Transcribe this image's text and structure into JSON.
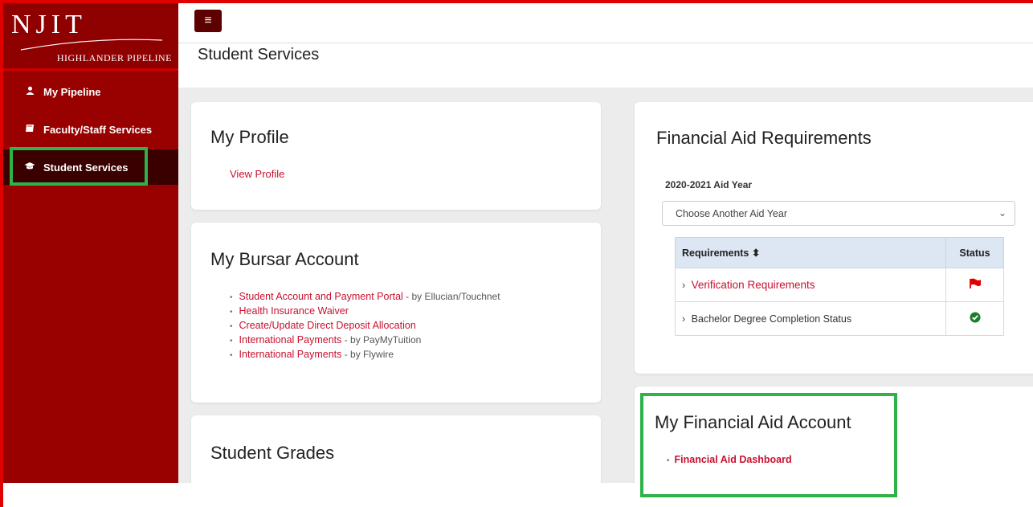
{
  "logo": {
    "name": "NJIT",
    "subtitle": "HIGHLANDER PIPELINE"
  },
  "sidebar": {
    "items": [
      {
        "label": "My Pipeline",
        "icon": "user-icon"
      },
      {
        "label": "Faculty/Staff Services",
        "icon": "book-icon"
      },
      {
        "label": "Student Services",
        "icon": "graduation-cap-icon"
      }
    ]
  },
  "header": {
    "menu_icon": "hamburger-icon",
    "title": "Student Services"
  },
  "profile": {
    "title": "My Profile",
    "link": "View Profile"
  },
  "bursar": {
    "title": "My Bursar Account",
    "links": [
      {
        "text": "Student Account and Payment Portal",
        "by": " - by Ellucian/Touchnet"
      },
      {
        "text": "Health Insurance Waiver",
        "by": ""
      },
      {
        "text": "Create/Update Direct Deposit Allocation",
        "by": ""
      },
      {
        "text": "International Payments",
        "by": " - by PayMyTuition"
      },
      {
        "text": "International Payments",
        "by": " - by Flywire"
      }
    ]
  },
  "grades": {
    "title": "Student Grades"
  },
  "fin_req": {
    "title": "Financial Aid Requirements",
    "aid_year": "2020-2021 Aid Year",
    "select_placeholder": "Choose Another Aid Year",
    "columns": [
      "Requirements ⬍",
      "Status"
    ],
    "rows": [
      {
        "label": "Verification Requirements",
        "status_icon": "red-flag-icon"
      },
      {
        "label": "Bachelor Degree Completion Status",
        "status_icon": "green-check-icon"
      }
    ]
  },
  "fin_account": {
    "title": "My Financial Aid Account",
    "link": "Financial Aid Dashboard"
  },
  "colors": {
    "sidebar": "#990000",
    "link": "#c8102e",
    "highlight": "#2db34a",
    "frame": "#e00000"
  }
}
